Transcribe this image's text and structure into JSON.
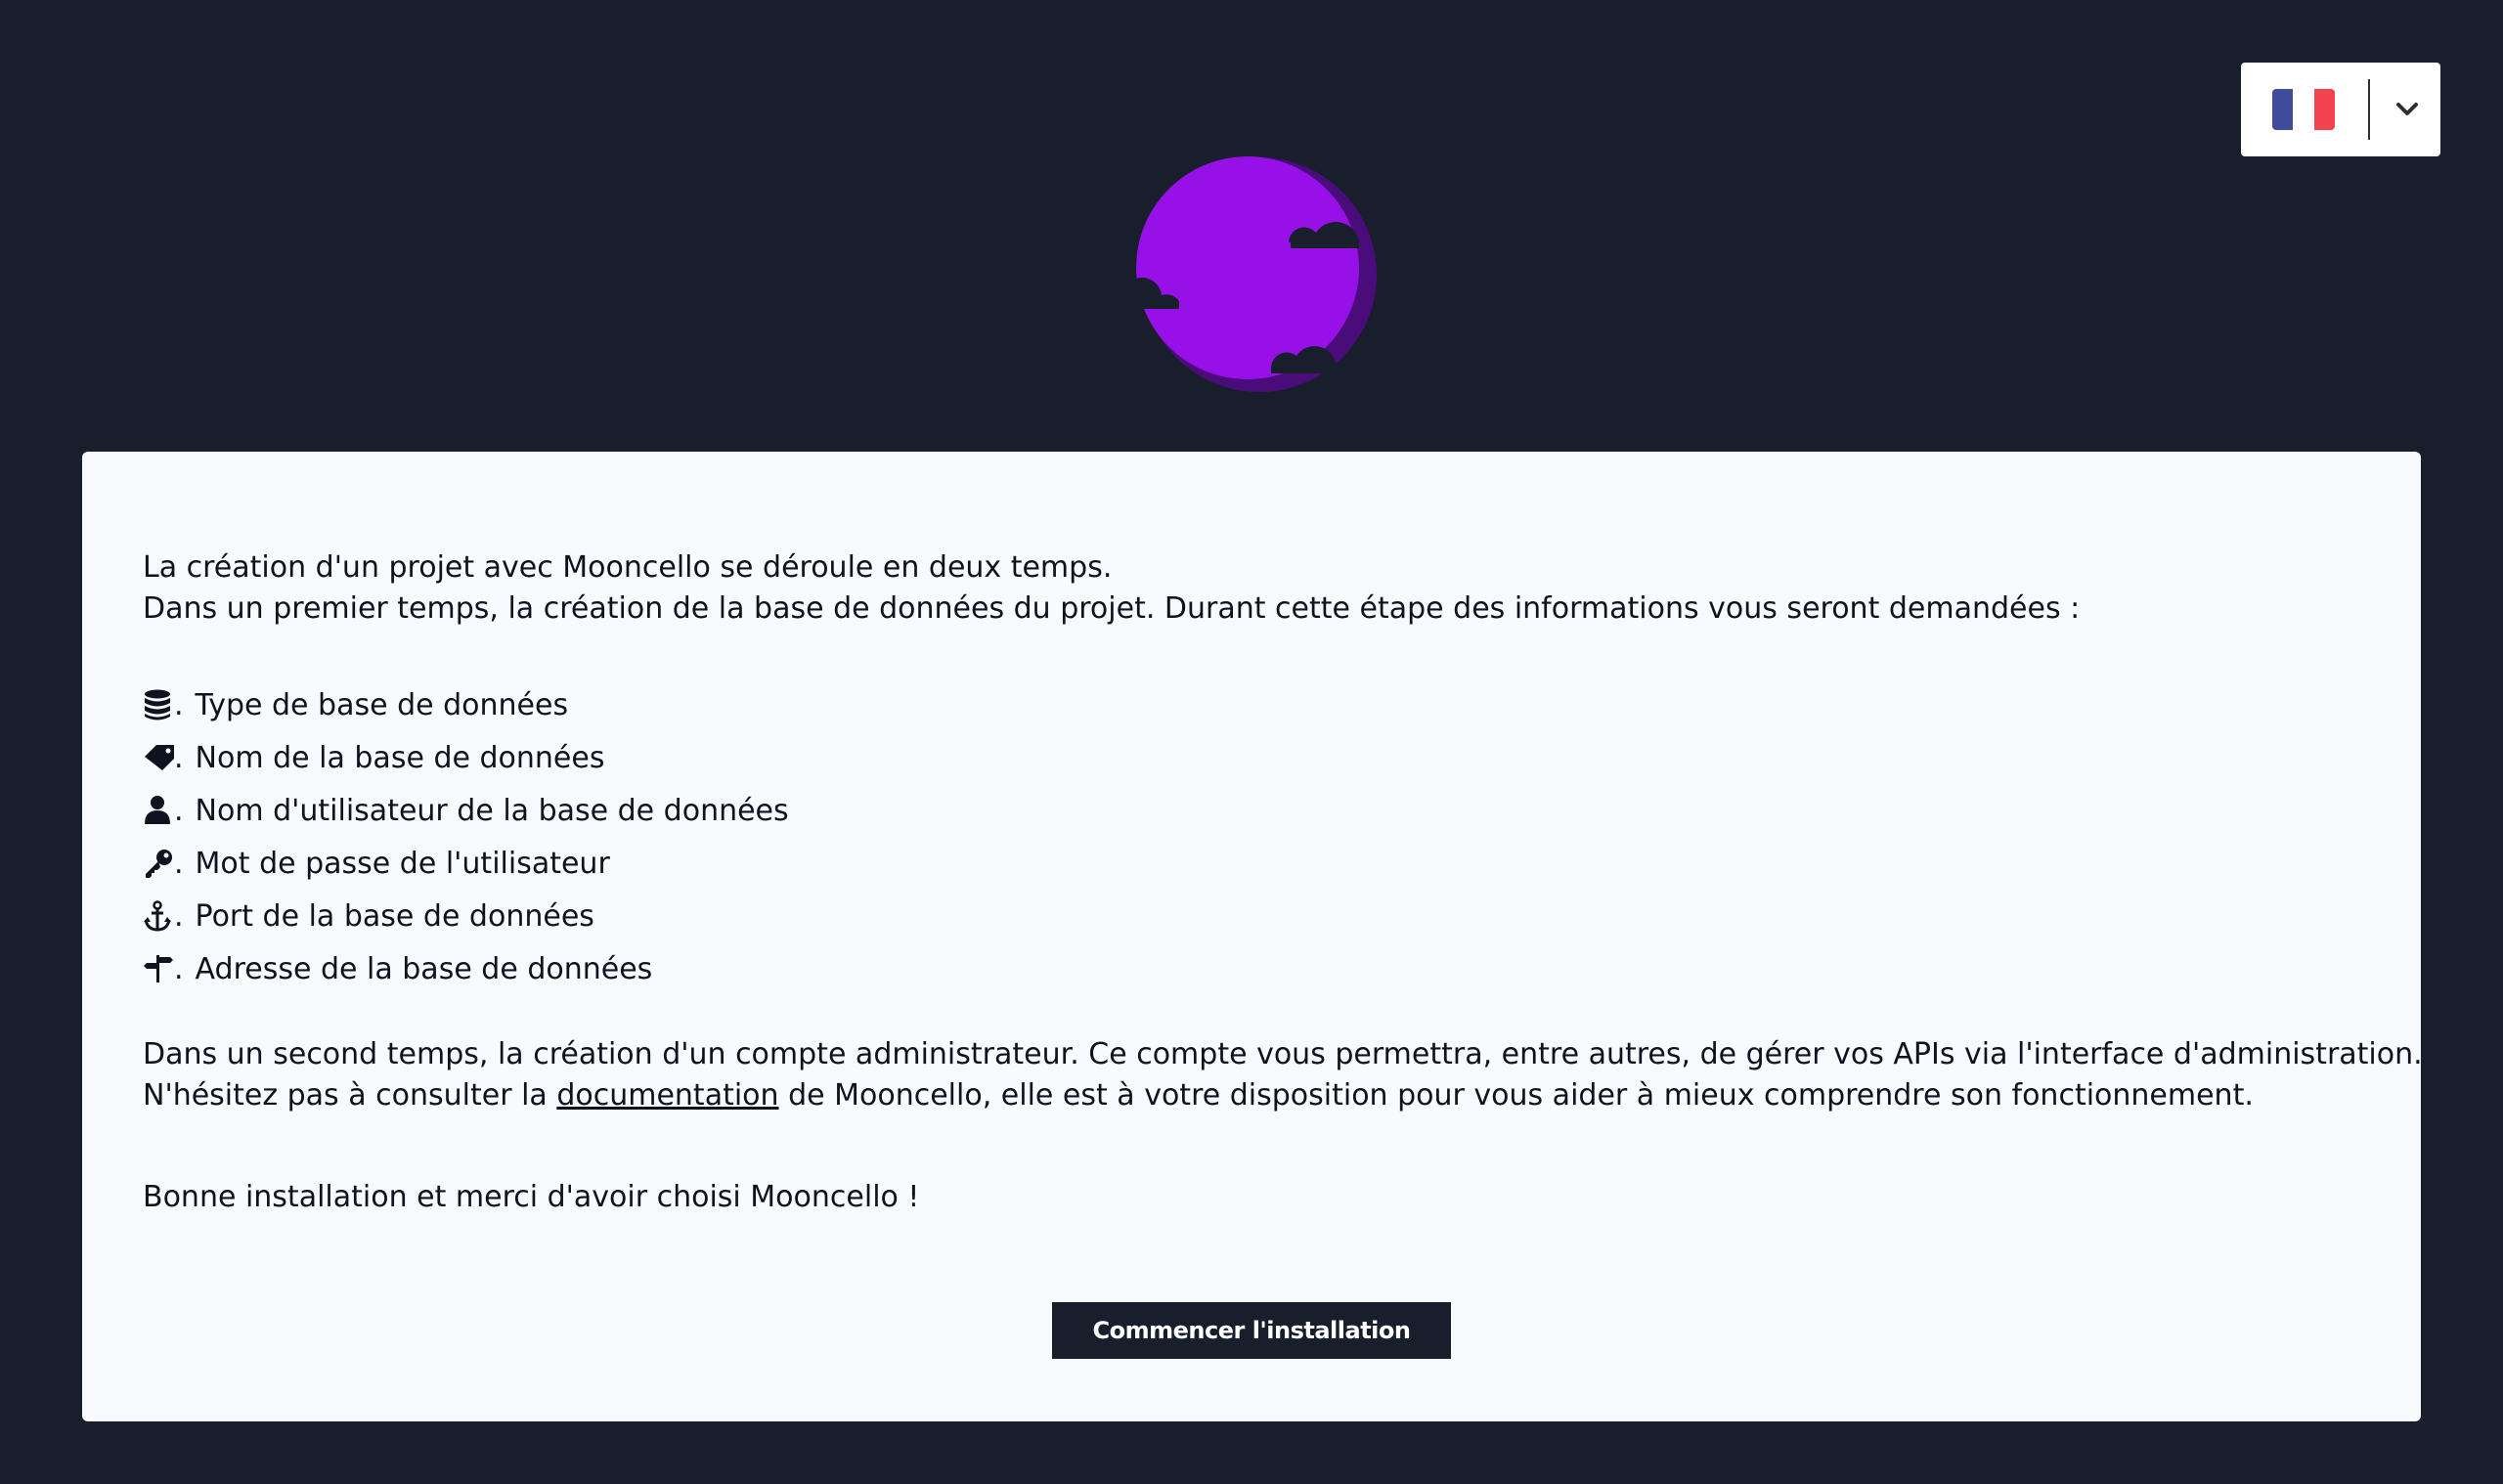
{
  "language_select": {
    "flag": "france-flag-icon",
    "colors": [
      "#404b9c",
      "#ffffff",
      "#f3424f"
    ]
  },
  "logo": {
    "moon_color": "#9810e8",
    "moon_shadow_color": "#4a0c7a"
  },
  "intro": {
    "line1": "La création d'un projet avec Mooncello se déroule en deux temps.",
    "line2": "Dans un premier temps, la création de la base de données du projet. Durant cette étape des informations vous seront demandées :"
  },
  "fields": [
    {
      "icon": "database-icon",
      "label": "Type de base de données"
    },
    {
      "icon": "tag-icon",
      "label": "Nom de la base de données"
    },
    {
      "icon": "user-icon",
      "label": "Nom d'utilisateur de la base de données"
    },
    {
      "icon": "key-icon",
      "label": "Mot de passe de l'utilisateur"
    },
    {
      "icon": "anchor-icon",
      "label": "Port de la base de données"
    },
    {
      "icon": "signpost-icon",
      "label": "Adresse de la base de données"
    }
  ],
  "second": {
    "line1": "Dans un second temps, la création d'un compte administrateur. Ce compte vous permettra, entre autres, de gérer vos APIs via l'interface d'administration.",
    "line2_before": "N'hésitez pas à consulter la ",
    "link": "documentation",
    "line2_after": " de Mooncello, elle est à votre disposition pour vous aider à mieux comprendre son fonctionnement."
  },
  "closing": "Bonne installation et merci d'avoir choisi Mooncello !",
  "start_button": "Commencer l'installation",
  "list_separator": "."
}
